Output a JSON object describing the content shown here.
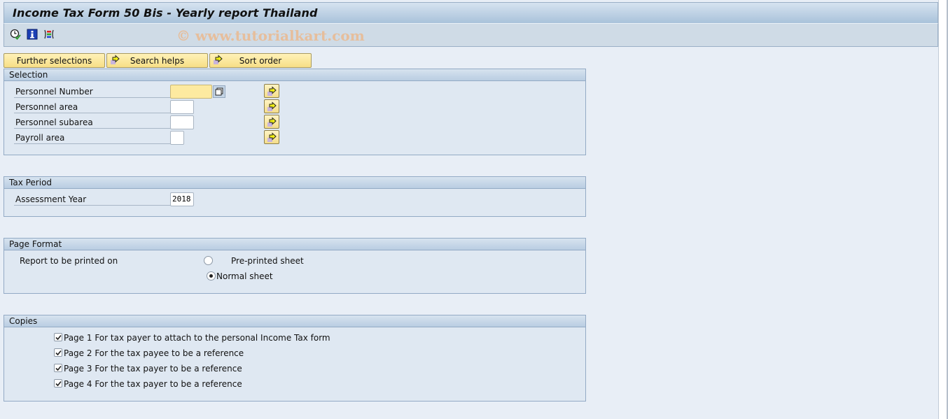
{
  "window": {
    "title": "Income Tax Form 50 Bis - Yearly report Thailand",
    "watermark": "© www.tutorialkart.com"
  },
  "toolbar": {
    "icons": [
      {
        "name": "execute-clock-icon",
        "tooltip": "Execute"
      },
      {
        "name": "information-icon",
        "tooltip": "Program documentation"
      },
      {
        "name": "selection-options-icon",
        "tooltip": "Selection options"
      }
    ]
  },
  "app_buttons": [
    {
      "label": "Further selections",
      "icon": ""
    },
    {
      "label": "Search helps",
      "icon": "arrow-right-icon"
    },
    {
      "label": "Sort order",
      "icon": "arrow-right-icon"
    }
  ],
  "selection": {
    "title": "Selection",
    "fields": [
      {
        "label": "Personnel Number",
        "value": "",
        "required": true
      },
      {
        "label": "Personnel area",
        "value": ""
      },
      {
        "label": "Personnel subarea",
        "value": ""
      },
      {
        "label": "Payroll area",
        "value": ""
      }
    ]
  },
  "tax_period": {
    "title": "Tax Period",
    "assessment_year_label": "Assessment Year",
    "assessment_year_value": "2018"
  },
  "page_format": {
    "title": "Page Format",
    "label": "Report to be printed on",
    "options": [
      {
        "label": "Pre-printed sheet",
        "selected": false
      },
      {
        "label": "Normal sheet",
        "selected": true
      }
    ]
  },
  "copies": {
    "title": "Copies",
    "items": [
      {
        "label": "Page 1 For tax payer to attach to the personal Income Tax form",
        "checked": true
      },
      {
        "label": "Page 2 For the tax payee to be a reference",
        "checked": true
      },
      {
        "label": "Page 3 For the tax payer to be a reference",
        "checked": true
      },
      {
        "label": "Page 4 For the tax payer to be a reference",
        "checked": true
      }
    ]
  },
  "colors": {
    "background": "#e8eef6",
    "button_yellow": "#f7df86",
    "required_field": "#fdeaa0",
    "group_border": "#93aac5"
  }
}
